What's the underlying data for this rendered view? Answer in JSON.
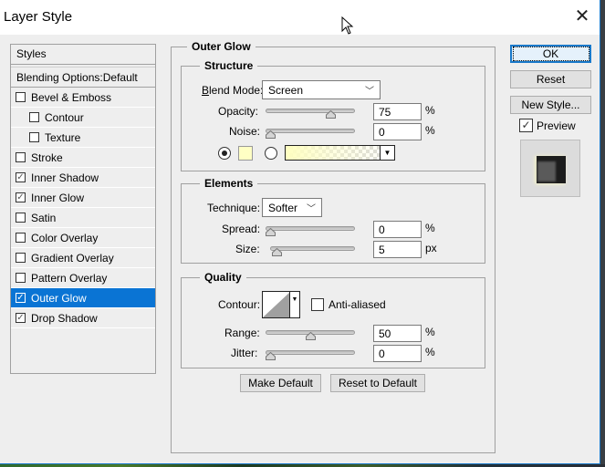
{
  "window": {
    "title": "Layer Style",
    "close_icon": "close-icon"
  },
  "styles_panel": {
    "header": "Styles",
    "blending_options": "Blending Options:Default",
    "items": [
      {
        "label": "Bevel & Emboss",
        "checked": false,
        "sub": false,
        "selected": false
      },
      {
        "label": "Contour",
        "checked": false,
        "sub": true,
        "selected": false
      },
      {
        "label": "Texture",
        "checked": false,
        "sub": true,
        "selected": false
      },
      {
        "label": "Stroke",
        "checked": false,
        "sub": false,
        "selected": false
      },
      {
        "label": "Inner Shadow",
        "checked": true,
        "sub": false,
        "selected": false
      },
      {
        "label": "Inner Glow",
        "checked": true,
        "sub": false,
        "selected": false
      },
      {
        "label": "Satin",
        "checked": false,
        "sub": false,
        "selected": false
      },
      {
        "label": "Color Overlay",
        "checked": false,
        "sub": false,
        "selected": false
      },
      {
        "label": "Gradient Overlay",
        "checked": false,
        "sub": false,
        "selected": false
      },
      {
        "label": "Pattern Overlay",
        "checked": false,
        "sub": false,
        "selected": false
      },
      {
        "label": "Outer Glow",
        "checked": true,
        "sub": false,
        "selected": true
      },
      {
        "label": "Drop Shadow",
        "checked": true,
        "sub": false,
        "selected": false
      }
    ]
  },
  "outer_glow": {
    "title": "Outer Glow",
    "structure": {
      "title": "Structure",
      "blend_mode": {
        "label": "Blend Mode:",
        "value": "Screen"
      },
      "opacity": {
        "label": "Opacity:",
        "value": "75",
        "unit": "%",
        "percent": 75
      },
      "noise": {
        "label": "Noise:",
        "value": "0",
        "unit": "%",
        "percent": 0
      },
      "color_mode": "solid",
      "solid_color": "#ffffc4"
    },
    "elements": {
      "title": "Elements",
      "technique": {
        "label": "Technique:",
        "value": "Softer"
      },
      "spread": {
        "label": "Spread:",
        "value": "0",
        "unit": "%",
        "percent": 0
      },
      "size": {
        "label": "Size:",
        "value": "5",
        "unit": "px",
        "fraction": 0.02
      }
    },
    "quality": {
      "title": "Quality",
      "contour_label": "Contour:",
      "anti_aliased": {
        "label": "Anti-aliased",
        "checked": false
      },
      "range": {
        "label": "Range:",
        "value": "50",
        "unit": "%",
        "percent": 50
      },
      "jitter": {
        "label": "Jitter:",
        "value": "0",
        "unit": "%",
        "percent": 0
      }
    },
    "make_default": "Make Default",
    "reset_to_default": "Reset to Default"
  },
  "actions": {
    "ok": "OK",
    "reset": "Reset",
    "new_style": "New Style...",
    "preview": {
      "label": "Preview",
      "checked": true
    }
  }
}
